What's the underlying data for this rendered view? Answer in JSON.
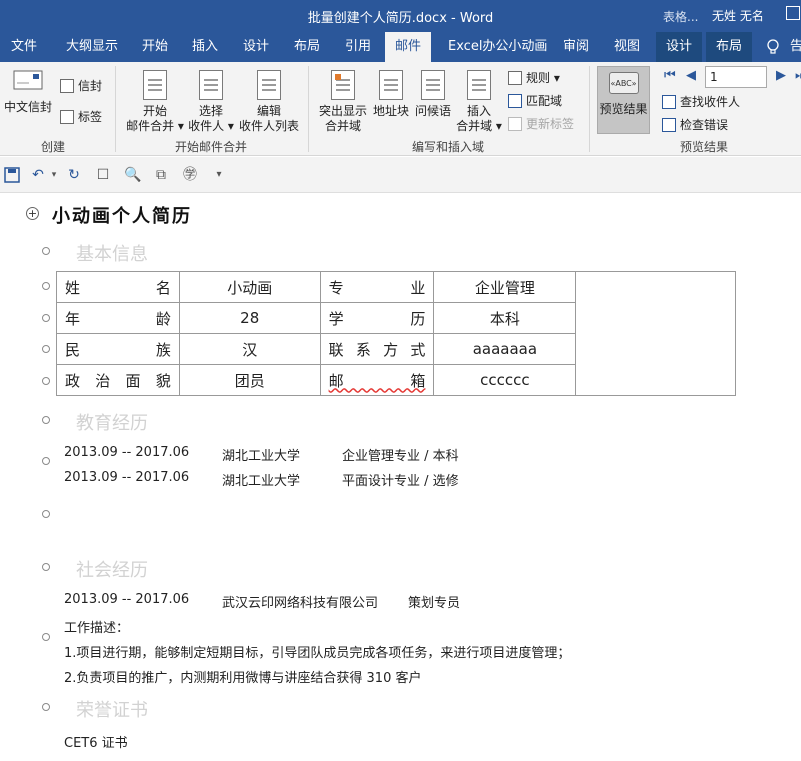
{
  "window": {
    "title": "批量创建个人简历.docx - Word",
    "search_hint": "表格...",
    "user": "无姓 无名"
  },
  "tabs": [
    {
      "label": "文件"
    },
    {
      "label": "大纲显示"
    },
    {
      "label": "开始"
    },
    {
      "label": "插入"
    },
    {
      "label": "设计"
    },
    {
      "label": "布局"
    },
    {
      "label": "引用"
    },
    {
      "label": "邮件"
    },
    {
      "label": "Excel办公小动画"
    },
    {
      "label": "审阅"
    },
    {
      "label": "视图"
    },
    {
      "label": "设计"
    },
    {
      "label": "布局"
    },
    {
      "label": "告"
    }
  ],
  "ribbon": {
    "create": {
      "label": "创建",
      "chinese_envelope": "中文信封",
      "envelope": "信封",
      "labels": "标签"
    },
    "start_merge": {
      "label": "开始邮件合并",
      "start_l1": "开始",
      "start_l2": "邮件合并",
      "select_l1": "选择",
      "select_l2": "收件人",
      "edit_l1": "编辑",
      "edit_l2": "收件人列表"
    },
    "write_insert": {
      "label": "编写和插入域",
      "highlight_l1": "突出显示",
      "highlight_l2": "合并域",
      "address": "地址块",
      "greeting": "问候语",
      "insert_l1": "插入",
      "insert_l2": "合并域",
      "rules": "规则",
      "match": "匹配域",
      "update": "更新标签"
    },
    "preview": {
      "label": "预览结果",
      "preview_btn": "预览结果",
      "abc": "«ABC»",
      "record": "1",
      "find": "查找收件人",
      "check": "检查错误"
    }
  },
  "document": {
    "title": "小动画个人简历",
    "sections": {
      "basic": "基本信息",
      "education": "教育经历",
      "social": "社会经历",
      "honors": "荣誉证书"
    },
    "table": [
      [
        "姓名",
        "小动画",
        "专业",
        "企业管理"
      ],
      [
        "年龄",
        "28",
        "学历",
        "本科"
      ],
      [
        "民族",
        "汉",
        "联系方式",
        "aaaaaaa"
      ],
      [
        "政治面貌",
        "团员",
        "邮箱",
        "cccccc"
      ]
    ],
    "education": [
      {
        "period": "2013.09 -- 2017.06",
        "school": "湖北工业大学",
        "major": "企业管理专业 / 本科"
      },
      {
        "period": "2013.09 -- 2017.06",
        "school": "湖北工业大学",
        "major": "平面设计专业 / 选修"
      }
    ],
    "social": {
      "period": "2013.09 -- 2017.06",
      "company": "武汉云印网络科技有限公司",
      "role": "策划专员",
      "desc_label": "工作描述：",
      "items": [
        "1.项目进行期，能够制定短期目标，引导团队成员完成各项任务，来进行项目进度管理；",
        "2.负责项目的推广，内测期利用微博与讲座结合获得 310 客户"
      ]
    },
    "honors": "CET6 证书"
  }
}
